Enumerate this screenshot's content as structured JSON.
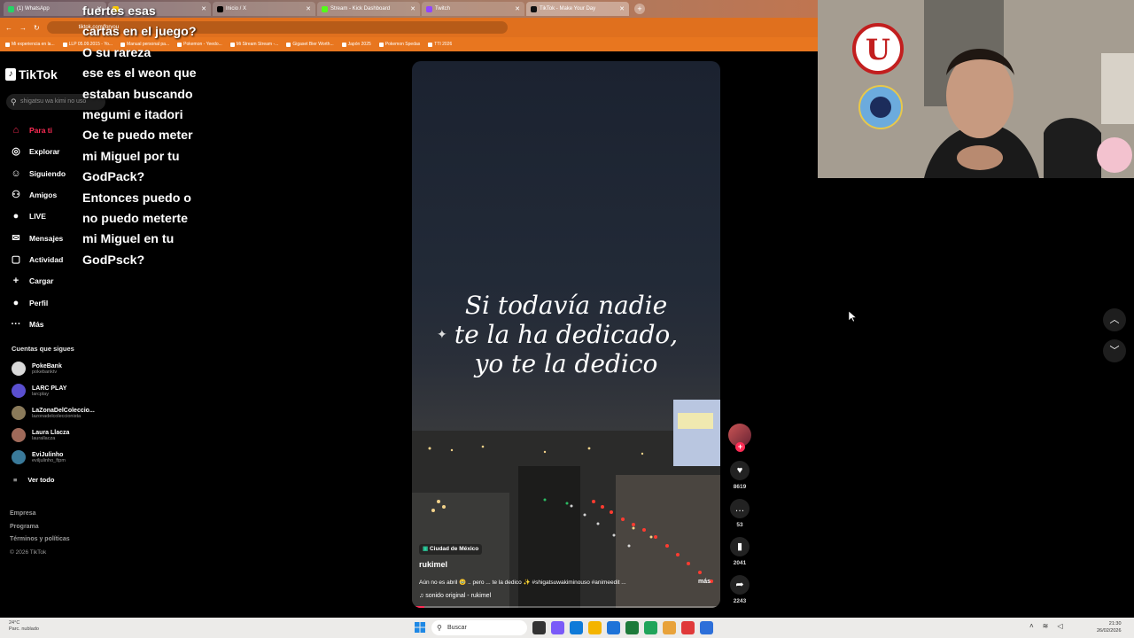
{
  "browser": {
    "tabs": [
      {
        "label": "(1) WhatsApp",
        "color": "#25d366",
        "active": false
      },
      {
        "label": "",
        "color": "#ffcc00",
        "active": false
      },
      {
        "label": "Inicio / X",
        "color": "#000000",
        "active": false
      },
      {
        "label": "Stream - Kick Dashboard",
        "color": "#53fc18",
        "active": false
      },
      {
        "label": "Twitch",
        "color": "#9146ff",
        "active": false
      },
      {
        "label": "TikTok - Make Your Day",
        "color": "#111111",
        "active": true
      }
    ],
    "address": "tiktok.com/foryou",
    "bookmarks": [
      "Mi experiencia en la...",
      "LLP 05.09.2015 - Yo...",
      "Manual personal pa...",
      "Pokemon - Yeedo...",
      "Mi Stream Stream -...",
      "Gigaset Bier Worth...",
      "Japón 2025",
      "Pokemon Spedas",
      "TTI 2026"
    ]
  },
  "sidebar": {
    "logo": "TikTok",
    "search_placeholder": "shigatsu wa kimi no uso",
    "nav": [
      {
        "label": "Para ti",
        "icon": "home-icon",
        "glyph": "⌂",
        "active": true
      },
      {
        "label": "Explorar",
        "icon": "compass-icon",
        "glyph": "◎",
        "active": false
      },
      {
        "label": "Siguiendo",
        "icon": "following-icon",
        "glyph": "☺",
        "active": false
      },
      {
        "label": "Amigos",
        "icon": "friends-icon",
        "glyph": "⚇",
        "active": false
      },
      {
        "label": "LIVE",
        "icon": "live-icon",
        "glyph": "●",
        "active": false
      },
      {
        "label": "Mensajes",
        "icon": "messages-icon",
        "glyph": "✉",
        "active": false
      },
      {
        "label": "Actividad",
        "icon": "activity-icon",
        "glyph": "▢",
        "active": false
      },
      {
        "label": "Cargar",
        "icon": "upload-icon",
        "glyph": "+",
        "active": false
      },
      {
        "label": "Perfil",
        "icon": "profile-icon",
        "glyph": "●",
        "active": false
      },
      {
        "label": "Más",
        "icon": "more-icon",
        "glyph": "···",
        "active": false
      }
    ],
    "following_title": "Cuentas que sigues",
    "following": [
      {
        "name": "PokeBank",
        "handle": "pokebanktv",
        "color": "#d9d9d9"
      },
      {
        "name": "LARC PLAY",
        "handle": "larcplay",
        "color": "#5a4fcf"
      },
      {
        "name": "LaZonaDelColeccio...",
        "handle": "lazonadelcoleccionista",
        "color": "#8a7a5a"
      },
      {
        "name": "Laura Llacza",
        "handle": "laurallacza",
        "color": "#a06a5a"
      },
      {
        "name": "EviJulinho",
        "handle": "eviljulinho_ftpm",
        "color": "#3a7a9a"
      }
    ],
    "see_all": "Ver todo",
    "footer": [
      "Empresa",
      "Programa",
      "Términos y políticas"
    ],
    "copyright": "© 2026 TikTok"
  },
  "chat": {
    "lines": [
      "fuertes esas",
      "cartas en el juego?",
      "O su rareza",
      "ese es el weon que",
      "estaban buscando",
      "megumi e itadori",
      "Oe te puedo meter",
      "mi Miguel por tu",
      "GodPack?",
      "Entonces puedo o",
      "no puedo meterte",
      "mi Miguel en tu",
      "GodPsck?"
    ]
  },
  "video": {
    "caption_lines": [
      "Si todavía nadie",
      "te la ha dedicado,",
      "yo te la dedico"
    ],
    "location": "Ciudad de México",
    "author": "rukimel",
    "description": "Aún no es abril 🥹 .. pero ... te la dedico ✨ #shigatsuwakiminouso #animeedit ...",
    "more": "más",
    "sound": "sonido original - rukimel",
    "progress": 0.04
  },
  "actions": {
    "likes": "8619",
    "comments": "53",
    "saves": "2041",
    "shares": "2243"
  },
  "taskbar": {
    "weather_temp": "24°C",
    "weather_desc": "Parc. nublado",
    "search": "Buscar",
    "time": "21:30",
    "date": "26/02/2026",
    "app_colors": [
      "#333333",
      "#7a5af8",
      "#0f7ad8",
      "#f4b400",
      "#1e73d8",
      "#1d7a3a",
      "#20a45a",
      "#e8a23a",
      "#e03a3a",
      "#2d6fd9"
    ]
  },
  "accent": "#fe2c55"
}
